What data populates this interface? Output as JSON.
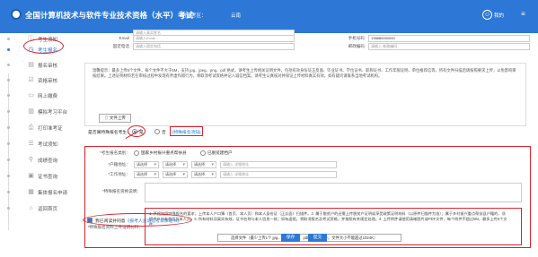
{
  "header": {
    "title": "全国计算机技术与软件专业技术资格（水平）考试",
    "region_label": "当前考区：",
    "region_value": "云南",
    "username": "我的"
  },
  "sidebar": {
    "items": [
      {
        "label": "考生须知",
        "icon": "info-icon"
      },
      {
        "label": "考生报名",
        "icon": "clock-icon",
        "active": true
      },
      {
        "label": "报名审核",
        "icon": "doc-icon"
      },
      {
        "label": "资格审核",
        "icon": "check-doc-icon"
      },
      {
        "label": "网上缴费",
        "icon": "payment-icon"
      },
      {
        "label": "模拟考习平台",
        "icon": "book-icon"
      },
      {
        "label": "打印准考证",
        "icon": "print-icon"
      },
      {
        "label": "考试须知",
        "icon": "list-icon"
      },
      {
        "label": "成绩查询",
        "icon": "search-icon"
      },
      {
        "label": "证书查询",
        "icon": "certificate-icon"
      },
      {
        "label": "集体报名申请",
        "icon": "group-icon"
      },
      {
        "label": "返回首页",
        "icon": "home-icon"
      }
    ]
  },
  "form": {
    "email_label": "Email",
    "email_placeholder": "请输入Email",
    "phone_label": "手机号码",
    "phone_value": "138880000000",
    "fixed_label": "固定电话",
    "fixed_placeholder": "请输入固定电话",
    "postcode_label": "邮政编码",
    "postcode_placeholder": "请输入 邮政编码",
    "top_placeholder": "请输入真实姓名"
  },
  "notice": {
    "text": "温馨提示：最多上传5个文件，每个文件不大于5M，支持 jpg、jpeg、png、pdf 格式，请考生上传相关证明文件，包括有效身份证正反面、毕业证书、学位证书、职称证书、工作年限证明、单位推荐信等，所有文件扫描后请按照要求上传，以免影响审核结果。上述证明材料若在审核过程中发现有弄虚作假行为，将取消考试资格并记入诚信档案。请考生认真核对并保证上传材料真实有效，如有疑问请联系当地考试机构。",
    "upload_label": "文件上传"
  },
  "privacy": {
    "question": "是否属特殊报名考生：",
    "yes": "是",
    "no": "否",
    "link": "[特殊报名须知]"
  },
  "special": {
    "type_label": "*考生报名类别：",
    "opt1": "国家乡村振兴重点帮扶县",
    "opt2": "已脱贫建档户",
    "hukou_label": "*户籍地址：",
    "work_label": "*工作地址：",
    "select_placeholder": "请选择",
    "addr_placeholder": "请输入 详细地址",
    "proof_label": "*特殊报名资格说明：",
    "material_label": "*特殊报名资料上传证明材料：",
    "material_note": "1. 严格按照特殊报名的要求；上传本人户口簿（首页、本人页）和本人身份证（正反面）扫描件。2. 属于脱贫户的还需上传脱贫户证明或享受政策证明材料（以原件扫描件为准）；属于乡村振兴重点帮扶县户籍的，须提供户口本首页及本人页。3. 所有材料须真实有效，证书名称与本人信息一致；如有虚假，将取消报名及考试资格，并按照有关规定处理。4. 上传附件请使用清晰图片或PDF文件，每个附件不超过5M，最多上传5个文件。",
    "attach_label": "选择文件（最少上传1个 jpg、jpeg、png、pdf格式的文件，文件大小不能超过1024K）"
  },
  "footer": {
    "agree_text": "我已阅读并同意",
    "agree_link": "《报考人员诚信考试承诺书》",
    "prev_label": "保存",
    "submit_label": "提交"
  }
}
